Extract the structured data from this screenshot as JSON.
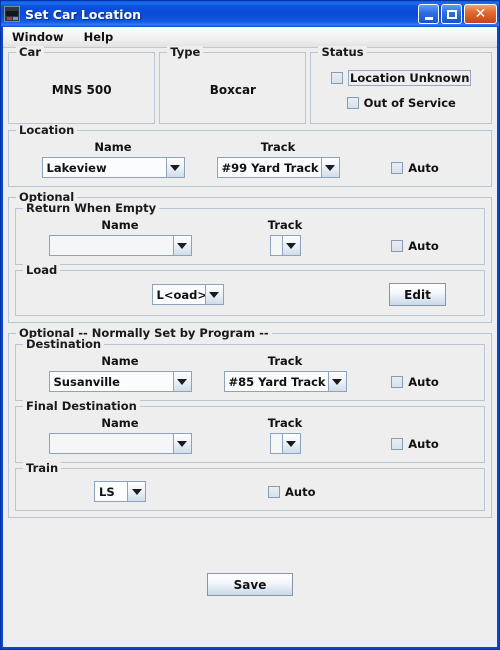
{
  "window": {
    "title": "Set Car Location",
    "icon": "locomotive-icon",
    "minimize_label": "Minimize",
    "maximize_label": "Maximize",
    "close_label": "✕",
    "accent_color": "#0a4ad6",
    "close_color": "#e36a34",
    "panel_color": "#eeeeee",
    "border_color": "#b8c6d8"
  },
  "menu": {
    "items": [
      {
        "label": "Window"
      },
      {
        "label": "Help"
      }
    ]
  },
  "car_panel": {
    "title": "Car",
    "value": "MNS 500"
  },
  "type_panel": {
    "title": "Type",
    "value": "Boxcar"
  },
  "status_panel": {
    "title": "Status",
    "location_unknown": {
      "label": "Location Unknown",
      "checked": false,
      "focused": true
    },
    "out_of_service": {
      "label": "Out of Service",
      "checked": false,
      "focused": false
    }
  },
  "location": {
    "title": "Location",
    "name_header": "Name",
    "track_header": "Track",
    "name_value": "Lakeview",
    "track_value": "#99 Yard Track",
    "auto_label": "Auto",
    "auto_checked": false
  },
  "optional": {
    "title": "Optional",
    "return_when_empty": {
      "title": "Return When Empty",
      "name_header": "Name",
      "track_header": "Track",
      "name_value": "",
      "track_value": "",
      "auto_label": "Auto",
      "auto_checked": false
    },
    "load": {
      "title": "Load",
      "value": "L<oad>",
      "edit_label": "Edit"
    }
  },
  "program": {
    "title": "Optional -- Normally Set by Program --",
    "destination": {
      "title": "Destination",
      "name_header": "Name",
      "track_header": "Track",
      "name_value": "Susanville",
      "track_value": "#85 Yard Track",
      "auto_label": "Auto",
      "auto_checked": false
    },
    "final_destination": {
      "title": "Final Destination",
      "name_header": "Name",
      "track_header": "Track",
      "name_value": "",
      "track_value": "",
      "auto_label": "Auto",
      "auto_checked": false
    },
    "train": {
      "title": "Train",
      "value": "LS",
      "auto_label": "Auto",
      "auto_checked": false
    }
  },
  "footer": {
    "save_label": "Save"
  }
}
